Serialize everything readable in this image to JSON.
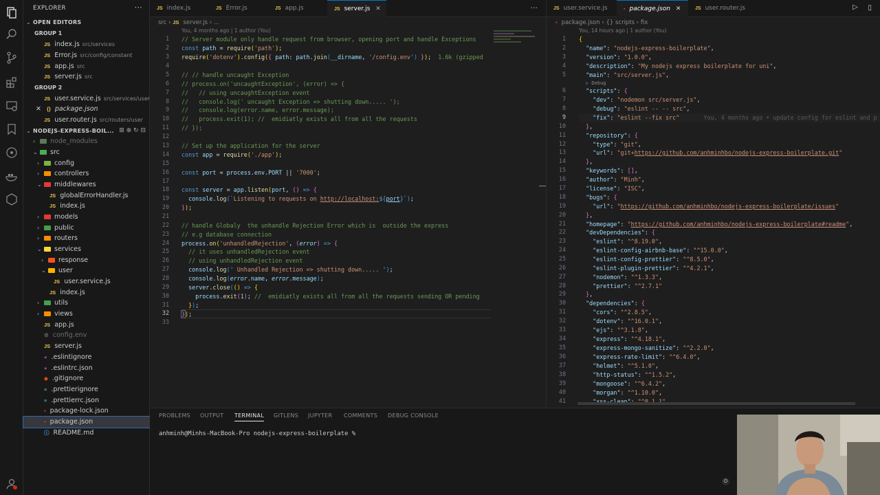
{
  "explorer": {
    "title": "EXPLORER",
    "open_editors": "OPEN EDITORS",
    "group1": "GROUP 1",
    "group1_files": [
      {
        "name": "index.js",
        "desc": "src/services"
      },
      {
        "name": "Error.js",
        "desc": "src/config/constant"
      },
      {
        "name": "app.js",
        "desc": "src"
      },
      {
        "name": "server.js",
        "desc": "src"
      }
    ],
    "group2": "GROUP 2",
    "group2_files": [
      {
        "name": "user.service.js",
        "desc": "src/services/user"
      },
      {
        "name": "package.json",
        "desc": ""
      },
      {
        "name": "user.router.js",
        "desc": "src/routers/user"
      }
    ],
    "project": "NODEJS-EXPRESS-BOIL...",
    "tree": [
      "node_modules",
      "src",
      "config",
      "controllers",
      "middlewares",
      "globalErrorHandler.js",
      "index.js",
      "models",
      "public",
      "routers",
      "services",
      "response",
      "user",
      "user.service.js",
      "index.js",
      "utils",
      "views",
      "app.js",
      "config.env",
      "server.js",
      ".eslintignore",
      ".eslintrc.json",
      ".gitignore",
      ".prettierignore",
      ".prettierrc.json",
      "package-lock.json",
      "package.json",
      "README.md"
    ]
  },
  "left_editor": {
    "tabs": [
      "index.js",
      "Error.js",
      "app.js",
      "server.js"
    ],
    "breadcrumb": [
      "src",
      "server.js",
      "..."
    ],
    "blame": "You, 4 months ago | 1 author (You)",
    "size_hint": "1.6k (gzipped"
  },
  "right_editor": {
    "tabs": [
      "user.service.js",
      "package.json",
      "user.router.js"
    ],
    "breadcrumb": [
      "package.json",
      "{} scripts",
      "fix"
    ],
    "blame": "You, 14 hours ago | 1 author (You)",
    "debug_hint": "▷ Debug",
    "inline_blame": "You, 4 months ago • update config for eslint and p"
  },
  "panel": {
    "tabs": [
      "PROBLEMS",
      "OUTPUT",
      "TERMINAL",
      "GITLENS",
      "JUPYTER",
      "COMMENTS",
      "DEBUG CONSOLE"
    ],
    "active_tab": "TERMINAL",
    "prompt": "anhminh@Minhs-MacBook-Pro nodejs-express-boilerplate %"
  },
  "accent": "#0078d4"
}
